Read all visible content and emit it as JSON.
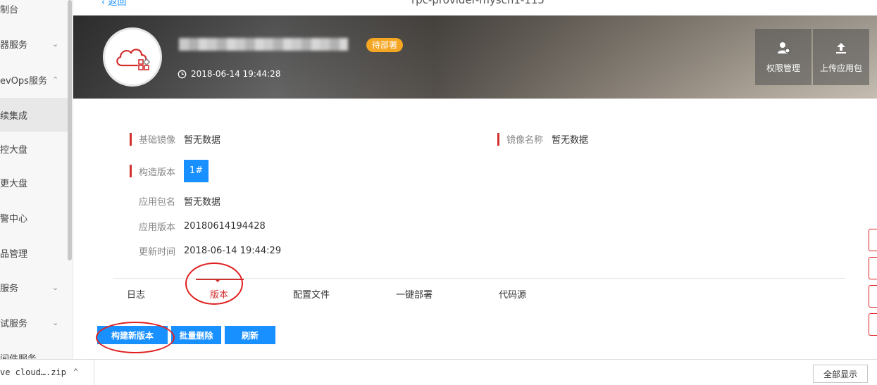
{
  "topbar": {
    "back_label": "返回",
    "title": "rpc-provider-mysch1-115"
  },
  "sidebar": {
    "items": [
      {
        "label": "制台",
        "chevron": ""
      },
      {
        "label": "器服务",
        "chevron": "⌄"
      },
      {
        "label": "evOps服务",
        "chevron": "⌃"
      },
      {
        "label": "续集成",
        "chevron": ""
      },
      {
        "label": "控大盘",
        "chevron": ""
      },
      {
        "label": "更大盘",
        "chevron": ""
      },
      {
        "label": "警中心",
        "chevron": ""
      },
      {
        "label": "品管理",
        "chevron": ""
      },
      {
        "label": "服务",
        "chevron": "⌄"
      },
      {
        "label": "试服务",
        "chevron": "⌄"
      },
      {
        "label": "间件服务",
        "chevron": ""
      }
    ]
  },
  "hero": {
    "status": "待部署",
    "time": "2018-06-14 19:44:28",
    "perm_label": "权限管理",
    "upload_label": "上传应用包"
  },
  "info": {
    "base_image_label": "基础镜像",
    "base_image_value": "暂无数据",
    "image_name_label": "镜像名称",
    "image_name_value": "暂无数据",
    "build_version_label": "构造版本",
    "build_version_value": "1#",
    "app_pkg_label": "应用包名",
    "app_pkg_value": "暂无数据",
    "app_version_label": "应用版本",
    "app_version_value": "20180614194428",
    "update_time_label": "更新时间",
    "update_time_value": "2018-06-14 19:44:29"
  },
  "tabs": [
    "日志",
    "版本",
    "配置文件",
    "一键部署",
    "代码源"
  ],
  "actions": {
    "build": "构建新版本",
    "batch_delete": "批量删除",
    "refresh": "刷新"
  },
  "download": {
    "file": "ve cloud….zip",
    "show_all": "全部显示"
  },
  "colors": {
    "accent": "#1890ff",
    "highlight": "#d32f2f",
    "badge": "#f5a623"
  }
}
